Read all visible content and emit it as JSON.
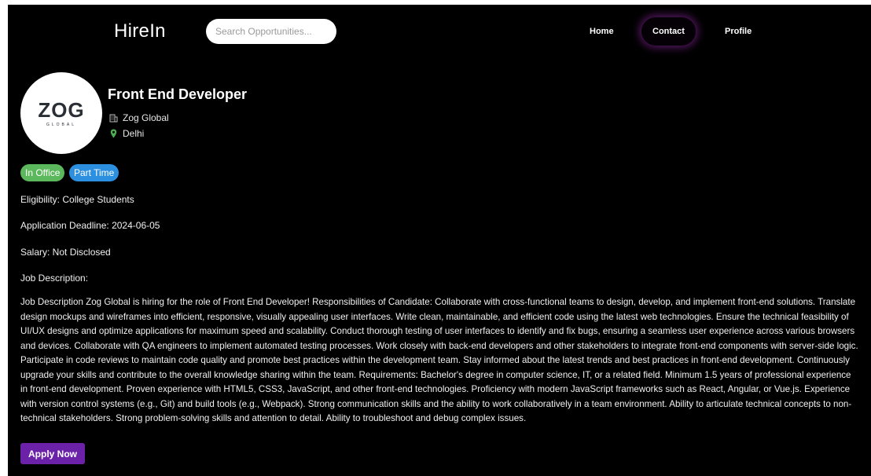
{
  "nav": {
    "brand": "HireIn",
    "search_placeholder": "Search Opportunities...",
    "links": [
      "Home",
      "Contact",
      "Profile"
    ],
    "active_link": "Contact"
  },
  "job": {
    "logo_mark": "ZOG",
    "logo_sub": "GLOBAL",
    "title": "Front End Developer",
    "company": "Zog Global",
    "location": "Delhi",
    "tags": [
      "In Office",
      "Part Time"
    ],
    "eligibility": "Eligibility: College Students",
    "deadline": "Application Deadline: 2024-06-05",
    "salary": "Salary: Not Disclosed",
    "description_label": "Job Description:",
    "description": "Job Description Zog Global is hiring for the role of Front End Developer! Responsibilities of Candidate: Collaborate with cross-functional teams to design, develop, and implement front-end solutions. Translate design mockups and wireframes into efficient, responsive, visually appealing user interfaces. Write clean, maintainable, and efficient code using the latest web technologies. Ensure the technical feasibility of UI/UX designs and optimize applications for maximum speed and scalability. Conduct thorough testing of user interfaces to identify and fix bugs, ensuring a seamless user experience across various browsers and devices. Collaborate with QA engineers to implement automated testing processes. Work closely with back-end developers and other stakeholders to integrate front-end components with server-side logic. Participate in code reviews to maintain code quality and promote best practices within the development team. Stay informed about the latest trends and best practices in front-end development. Continuously upgrade your skills and contribute to the overall knowledge sharing within the team. Requirements: Bachelor's degree in computer science, IT, or a related field. Minimum 1.5 years of professional experience in front-end development. Proven experience with HTML5, CSS3, JavaScript, and other front-end technologies. Proficiency with modern JavaScript frameworks such as React, Angular, or Vue.js. Experience with version control systems (e.g., Git) and build tools (e.g., Webpack). Strong communication skills and the ability to work collaboratively in a team environment. Ability to articulate technical concepts to non-technical stakeholders. Strong problem-solving skills and attention to detail. Ability to troubleshoot and debug complex issues.",
    "apply_label": "Apply Now"
  },
  "icons": {
    "company": "building-icon",
    "location": "map-pin-icon"
  },
  "colors": {
    "background": "#000000",
    "tag_in_office": "#5cb85c",
    "tag_part_time": "#2d8fe0",
    "apply_button": "#6b22a8",
    "contact_glow": "#9628aa",
    "location_pin": "#4caf50"
  }
}
